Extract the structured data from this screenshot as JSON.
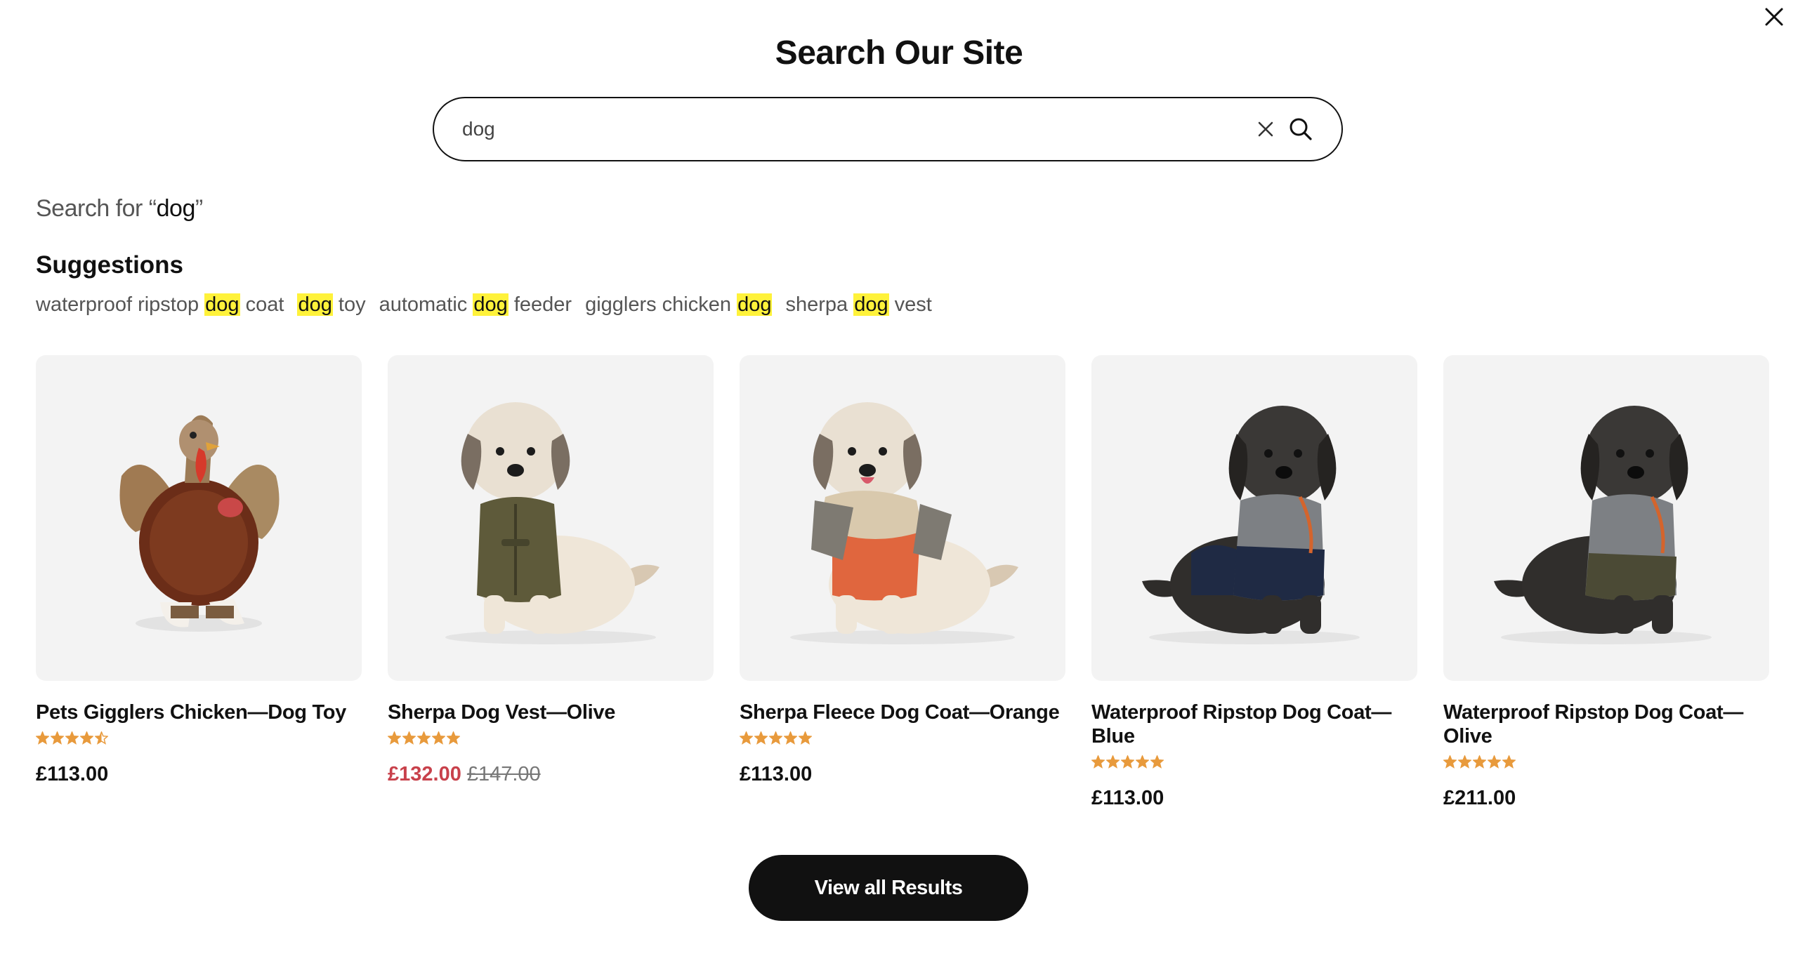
{
  "modal": {
    "title": "Search Our Site",
    "close_icon": "close-icon"
  },
  "search": {
    "value": "dog",
    "clear_icon": "clear-icon",
    "search_icon": "search-icon",
    "search_for_prefix": "Search for “",
    "search_for_suffix": "”"
  },
  "suggestions": {
    "heading": "Suggestions",
    "items": [
      {
        "before": "waterproof ripstop ",
        "match": "dog",
        "after": " coat"
      },
      {
        "before": "",
        "match": "dog",
        "after": " toy"
      },
      {
        "before": "automatic ",
        "match": "dog",
        "after": " feeder"
      },
      {
        "before": "gigglers chicken ",
        "match": "dog",
        "after": ""
      },
      {
        "before": "sherpa ",
        "match": "dog",
        "after": " vest"
      }
    ],
    "highlight_color": "#fff23a"
  },
  "products": [
    {
      "name": "Pets Gigglers Chicken—Dog Toy",
      "rating": 4.5,
      "price": "£113.00",
      "old_price": "",
      "image": "chicken-dog-toy"
    },
    {
      "name": "Sherpa Dog Vest—Olive",
      "rating": 5,
      "price": "£132.00",
      "old_price": "£147.00",
      "image": "dog-olive-vest"
    },
    {
      "name": "Sherpa Fleece Dog Coat—Orange",
      "rating": 5,
      "price": "£113.00",
      "old_price": "",
      "image": "dog-orange-coat"
    },
    {
      "name": "Waterproof Ripstop Dog Coat—Blue",
      "rating": 5,
      "price": "£113.00",
      "old_price": "",
      "image": "dog-blue-coat"
    },
    {
      "name": "Waterproof Ripstop Dog Coat—Olive",
      "rating": 5,
      "price": "£211.00",
      "old_price": "",
      "image": "dog-olive-coat"
    }
  ],
  "colors": {
    "star": "#e89a3c",
    "sale_price": "#c8414b",
    "button_bg": "#111111"
  },
  "actions": {
    "view_all_label": "View all Results"
  }
}
